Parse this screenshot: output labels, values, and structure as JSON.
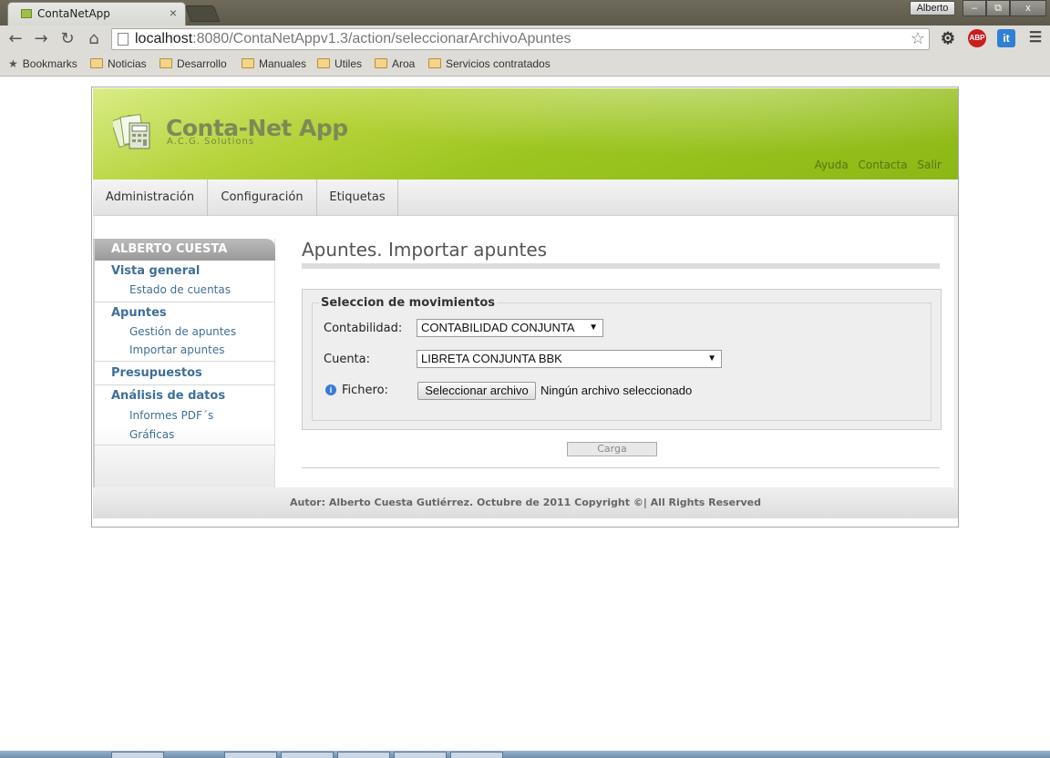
{
  "browser": {
    "tab_title": "ContaNetApp",
    "tab_close": "×",
    "user_name": "Alberto",
    "win_min": "–",
    "win_max": "⧉",
    "win_close": "x",
    "url_host": "localhost",
    "url_rest": ":8080/ContaNetAppv1.3/action/seleccionarArchivoApuntes",
    "bookmarks_label": "Bookmarks",
    "bookmark_folders": [
      "Noticias",
      "Desarrollo",
      "Manuales",
      "Utiles",
      "Aroa",
      "Servicios contratados"
    ],
    "ext_abp": "ABP",
    "ext_it": "it"
  },
  "header": {
    "title": "Conta-Net App",
    "subtitle": "A.C.G. Solutions",
    "links": [
      "Ayuda",
      "Contacta",
      "Salir"
    ]
  },
  "menu": [
    "Administración",
    "Configuración",
    "Etiquetas"
  ],
  "sidebar": {
    "user": "ALBERTO CUESTA",
    "sections": [
      {
        "title": "Vista general",
        "items": [
          "Estado de cuentas"
        ]
      },
      {
        "title": "Apuntes",
        "items": [
          "Gestión de apuntes",
          "Importar apuntes"
        ]
      },
      {
        "title": "Presupuestos",
        "items": []
      },
      {
        "title": "Análisis de datos",
        "items": [
          "Informes PDF´s",
          "Gráficas"
        ]
      }
    ]
  },
  "main": {
    "title": "Apuntes. Importar apuntes",
    "legend": "Seleccion de movimientos",
    "contabilidad_label": "Contabilidad:",
    "contabilidad_value": "CONTABILIDAD CONJUNTA",
    "cuenta_label": "Cuenta:",
    "cuenta_value": "LIBRETA CONJUNTA BBK",
    "fichero_label": "Fichero:",
    "file_button": "Seleccionar archivo",
    "file_status": "Ningún archivo seleccionado",
    "submit": "Carga"
  },
  "footer": "Autor: Alberto Cuesta Gutiérrez. Octubre de 2011 Copyright ©| All Rights Reserved",
  "colors": {
    "banner_green": "#9cc51f",
    "link_blue": "#3f6f96"
  }
}
